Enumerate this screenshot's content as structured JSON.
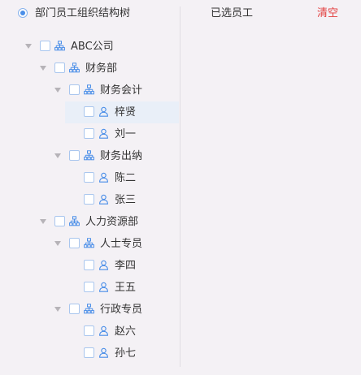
{
  "left_panel": {
    "title": "部门员工组织结构树"
  },
  "right_panel": {
    "title": "已选员工",
    "clear_label": "清空"
  },
  "colors": {
    "accent": "#4a8ee8",
    "clear": "#e23c3c",
    "selected_row": "#e9eff8"
  },
  "tree": [
    {
      "label": "ABC公司",
      "type": "org",
      "level": 0,
      "expandable": true,
      "selected": false
    },
    {
      "label": "财务部",
      "type": "org",
      "level": 1,
      "expandable": true,
      "selected": false
    },
    {
      "label": "财务会计",
      "type": "org",
      "level": 2,
      "expandable": true,
      "selected": false
    },
    {
      "label": "梓贤",
      "type": "person",
      "level": 3,
      "expandable": false,
      "selected": true
    },
    {
      "label": "刘一",
      "type": "person",
      "level": 3,
      "expandable": false,
      "selected": false
    },
    {
      "label": "财务出纳",
      "type": "org",
      "level": 2,
      "expandable": true,
      "selected": false
    },
    {
      "label": "陈二",
      "type": "person",
      "level": 3,
      "expandable": false,
      "selected": false
    },
    {
      "label": "张三",
      "type": "person",
      "level": 3,
      "expandable": false,
      "selected": false
    },
    {
      "label": "人力资源部",
      "type": "org",
      "level": 1,
      "expandable": true,
      "selected": false
    },
    {
      "label": "人士专员",
      "type": "org",
      "level": 2,
      "expandable": true,
      "selected": false
    },
    {
      "label": "李四",
      "type": "person",
      "level": 3,
      "expandable": false,
      "selected": false
    },
    {
      "label": "王五",
      "type": "person",
      "level": 3,
      "expandable": false,
      "selected": false
    },
    {
      "label": "行政专员",
      "type": "org",
      "level": 2,
      "expandable": true,
      "selected": false
    },
    {
      "label": "赵六",
      "type": "person",
      "level": 3,
      "expandable": false,
      "selected": false
    },
    {
      "label": "孙七",
      "type": "person",
      "level": 3,
      "expandable": false,
      "selected": false
    }
  ]
}
